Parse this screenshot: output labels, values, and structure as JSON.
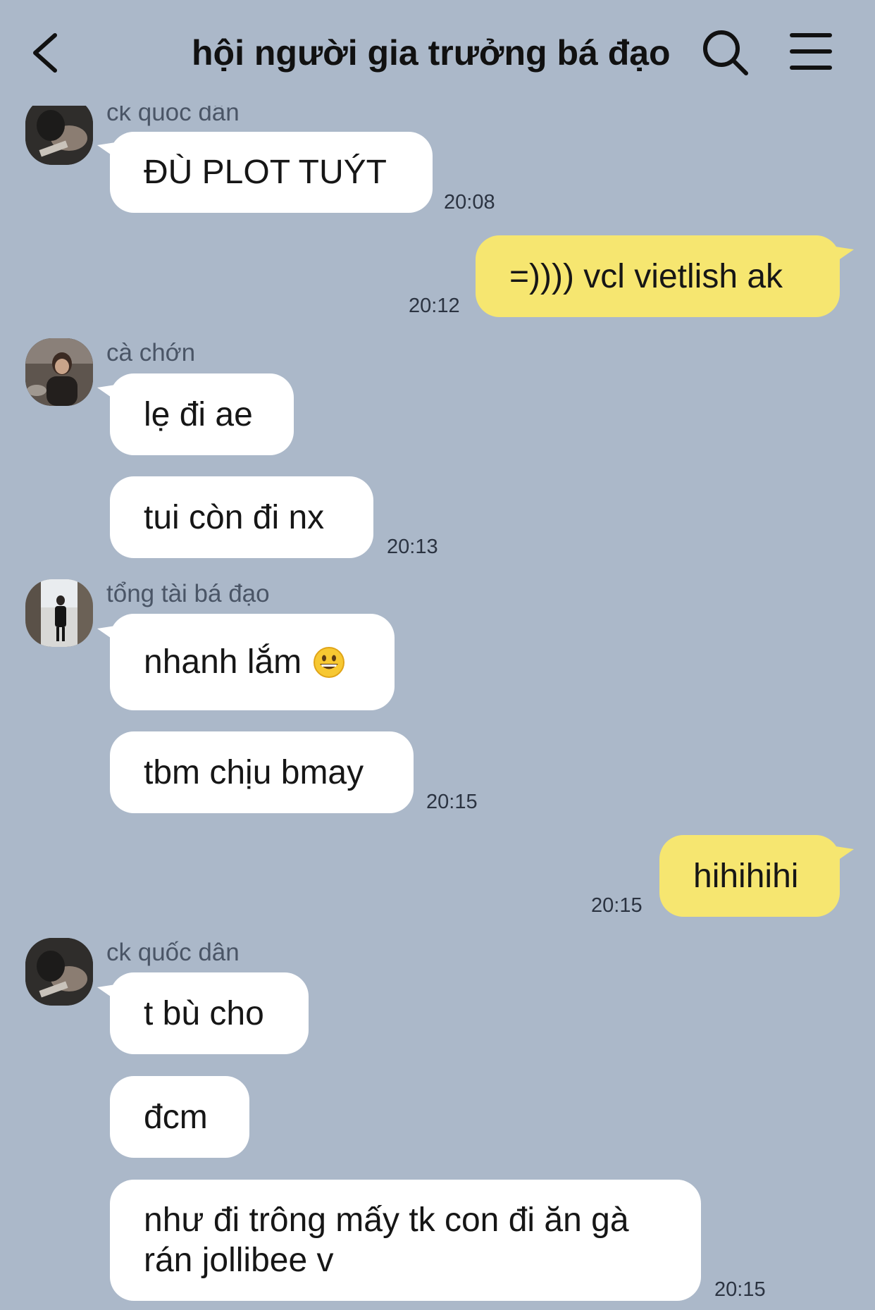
{
  "header": {
    "title": "hội người gia trưởng bá đạo",
    "back_icon": "chevron-left-icon",
    "search_icon": "search-icon",
    "menu_icon": "hamburger-menu-icon"
  },
  "colors": {
    "background": "#abb8c9",
    "incoming_bubble": "#ffffff",
    "outgoing_bubble": "#f6e670"
  },
  "messages": [
    {
      "sender": "ck quốc dân",
      "text": "ĐÙ PLOT TUÝT",
      "time": "20:08"
    },
    {
      "text": "=)))) vcl vietlish ak",
      "time": "20:12",
      "outgoing": true
    },
    {
      "sender": "cà chớn",
      "text": "lẹ đi ae"
    },
    {
      "text": "tui còn đi nx",
      "time": "20:13"
    },
    {
      "sender": "tổng tài bá đạo",
      "text": "nhanh lắm",
      "emoji": "grinning-face"
    },
    {
      "text": "tbm chịu bmay",
      "time": "20:15"
    },
    {
      "text": "hihihihi",
      "time": "20:15",
      "outgoing": true
    },
    {
      "sender": "ck quốc dân",
      "text": "t bù cho"
    },
    {
      "text": "đcm"
    },
    {
      "text": "như đi trông mấy tk con đi ăn gà rán jollibee v",
      "time": "20:15"
    }
  ]
}
